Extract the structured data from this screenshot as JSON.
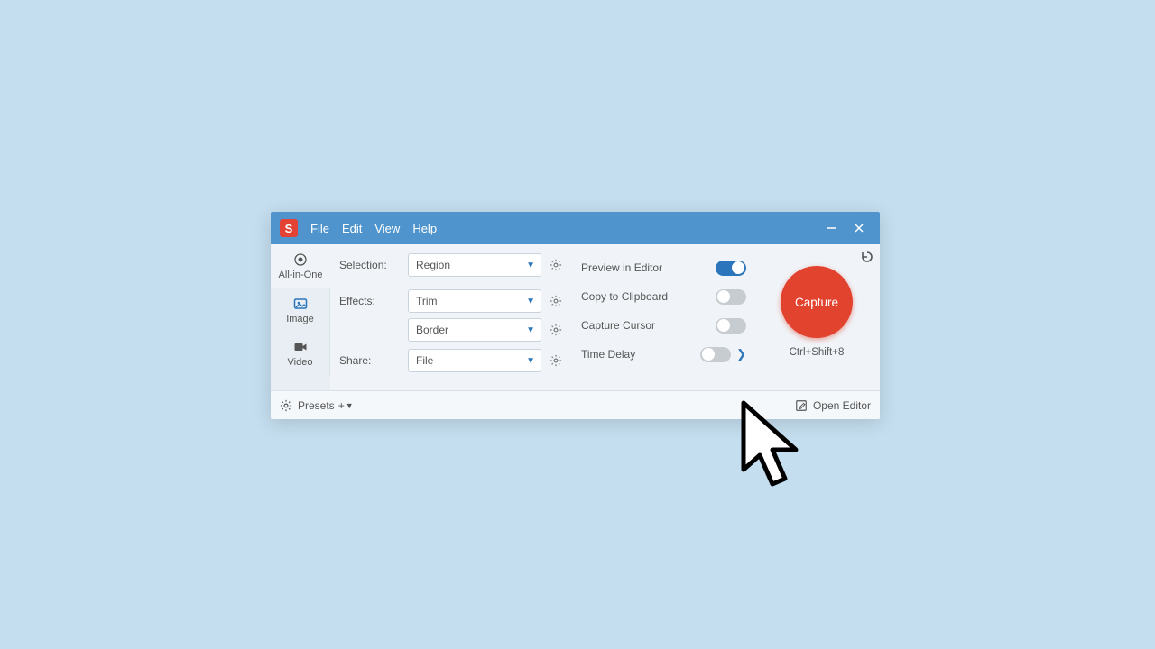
{
  "app_icon_letter": "S",
  "menu": {
    "file": "File",
    "edit": "Edit",
    "view": "View",
    "help": "Help"
  },
  "tabs": {
    "all_in_one": "All-in-One",
    "image": "Image",
    "video": "Video"
  },
  "settings": {
    "selection_label": "Selection:",
    "selection_value": "Region",
    "effects_label": "Effects:",
    "effects_value1": "Trim",
    "effects_value2": "Border",
    "share_label": "Share:",
    "share_value": "File"
  },
  "toggles": {
    "preview": "Preview in Editor",
    "clipboard": "Copy to Clipboard",
    "cursor": "Capture Cursor",
    "delay": "Time Delay"
  },
  "capture": {
    "button": "Capture",
    "shortcut": "Ctrl+Shift+8"
  },
  "footer": {
    "presets": "Presets",
    "open_editor": "Open Editor"
  }
}
